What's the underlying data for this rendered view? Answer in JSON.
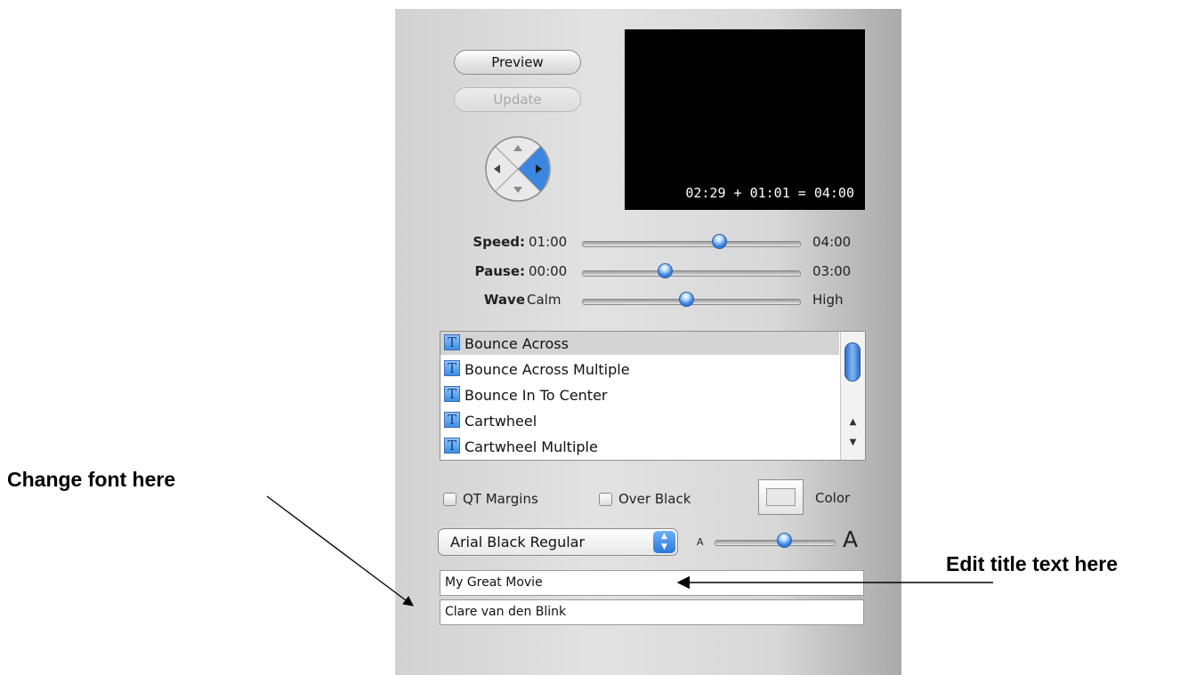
{
  "buttons": {
    "preview": "Preview",
    "update": "Update"
  },
  "preview": {
    "timecode": "02:29 + 01:01 = 04:00"
  },
  "sliders": [
    {
      "label": "Speed:",
      "min": "01:00",
      "max": "04:00",
      "value": 0.63
    },
    {
      "label": "Pause:",
      "min": "00:00",
      "max": "03:00",
      "value": 0.38
    },
    {
      "label": "Wave",
      "min": "Calm",
      "max": "High",
      "value": 0.48
    }
  ],
  "effects_list": {
    "items": [
      {
        "icon": "T",
        "label": "Bounce Across",
        "selected": true
      },
      {
        "icon": "T",
        "label": "Bounce Across Multiple"
      },
      {
        "icon": "T",
        "label": "Bounce In To Center"
      },
      {
        "icon": "T",
        "label": "Cartwheel"
      },
      {
        "icon": "T",
        "label": "Cartwheel Multiple"
      }
    ]
  },
  "options": {
    "qt_margins": "QT Margins",
    "over_black": "Over Black",
    "color": "Color"
  },
  "font": {
    "selected": "Arial Black Regular",
    "size_small": "A",
    "size_large": "A",
    "size_value": 0.58
  },
  "title_fields": [
    "My Great Movie",
    "Clare van den Blink"
  ],
  "annotations": {
    "change_font": "Change font here",
    "edit_title": "Edit title text here"
  },
  "colors": {
    "accent": "#3d87e0",
    "panel": "#d8d8d8"
  }
}
